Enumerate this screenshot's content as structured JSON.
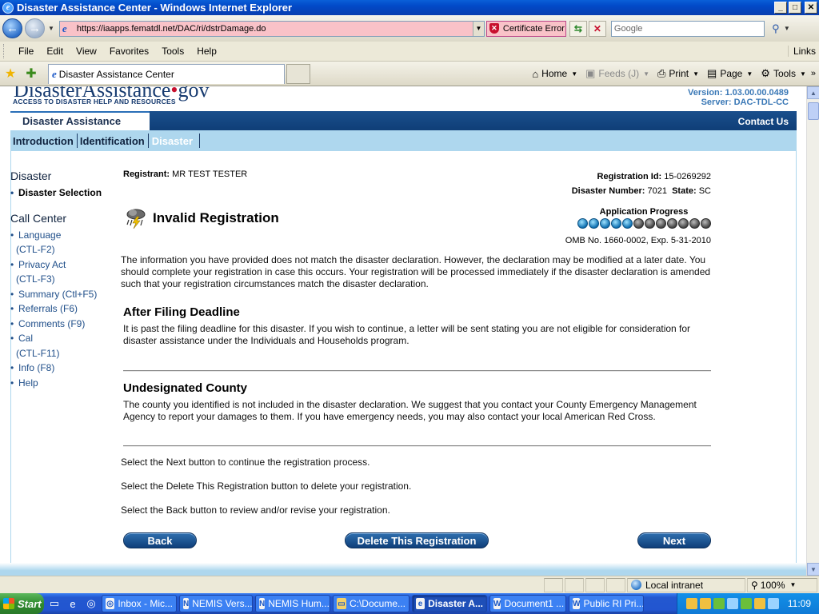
{
  "window": {
    "title": "Disaster Assistance Center - Windows Internet Explorer",
    "min_label": "_",
    "max_label": "□",
    "close_label": "✕"
  },
  "address": {
    "url": "https://iaapps.fematdl.net/DAC/ri/dstrDamage.do",
    "cert_error": "Certificate Error",
    "search_placeholder": "Google"
  },
  "menu": {
    "items": [
      "File",
      "Edit",
      "View",
      "Favorites",
      "Tools",
      "Help"
    ],
    "links": "Links"
  },
  "tabbar": {
    "tab_title": "Disaster Assistance Center",
    "home": "Home",
    "feeds": "Feeds (J)",
    "print": "Print",
    "page": "Page",
    "tools": "Tools"
  },
  "site": {
    "logo_main": "DisasterAssistance",
    "logo_dot": "•",
    "logo_gov": "gov",
    "logo_tagline": "ACCESS TO DISASTER HELP AND RESOURCES",
    "version": "Version: 1.03.00.00.0489",
    "server": "Server: DAC-TDL-CC",
    "section": "Disaster Assistance",
    "contact": "Contact Us",
    "steps": [
      "Introduction",
      "Identification",
      "Disaster"
    ]
  },
  "sidebar": {
    "heading1": "Disaster",
    "item_disaster_selection": "Disaster Selection",
    "heading2": "Call Center",
    "links": [
      {
        "line1": "Language",
        "line2": "(CTL-F2)"
      },
      {
        "line1": "Privacy Act",
        "line2": "(CTL-F3)"
      },
      {
        "line1": "Summary (Ctl+F5)",
        "line2": ""
      },
      {
        "line1": "Referrals (F6)",
        "line2": ""
      },
      {
        "line1": "Comments (F9)",
        "line2": ""
      },
      {
        "line1": "Cal",
        "line2": "(CTL-F11)"
      },
      {
        "line1": "Info (F8)",
        "line2": ""
      },
      {
        "line1": "Help",
        "line2": ""
      }
    ]
  },
  "registration": {
    "registrant_label": "Registrant:",
    "registrant": "MR TEST TESTER",
    "reg_id_label": "Registration Id:",
    "reg_id": "15-0269292",
    "disaster_number_label": "Disaster Number:",
    "disaster_number": "7021",
    "state_label": "State:",
    "state": "SC"
  },
  "content": {
    "title": "Invalid Registration",
    "progress_label": "Application Progress",
    "progress_done": 5,
    "progress_total": 12,
    "omb": "OMB No. 1660-0002, Exp. 5-31-2010",
    "intro": "The information you have provided does not match the disaster declaration. However, the declaration may be modified at a later date. You should complete your registration in case this occurs. Your registration will be processed immediately if the disaster declaration is amended such that your registration circumstances match the disaster declaration.",
    "section1_title": "After Filing Deadline",
    "section1_text": "It is past the filing deadline for this disaster. If you wish to continue, a letter will be sent stating you are not eligible for consideration for disaster assistance under the Individuals and Households program.",
    "section2_title": "Undesignated County",
    "section2_text": "The county you identified is not included in the disaster declaration. We suggest that you contact your County Emergency Management Agency to report your damages to them. If you have emergency needs, you may also contact your local American Red Cross.",
    "instr_next": "Select the Next button to continue the registration process.",
    "instr_delete": "Select the Delete This Registration button to delete your registration.",
    "instr_back": "Select the Back button to review and/or revise your registration.",
    "btn_back": "Back",
    "btn_delete": "Delete This Registration",
    "btn_next": "Next"
  },
  "status": {
    "zone": "Local intranet",
    "zoom": "100%"
  },
  "taskbar": {
    "start": "Start",
    "tasks": [
      "Inbox - Mic...",
      "NEMIS Vers...",
      "NEMIS Hum...",
      "C:\\Docume...",
      "Disaster A...",
      "Document1 ...",
      "Public RI Pri..."
    ],
    "clock": "11:09"
  }
}
